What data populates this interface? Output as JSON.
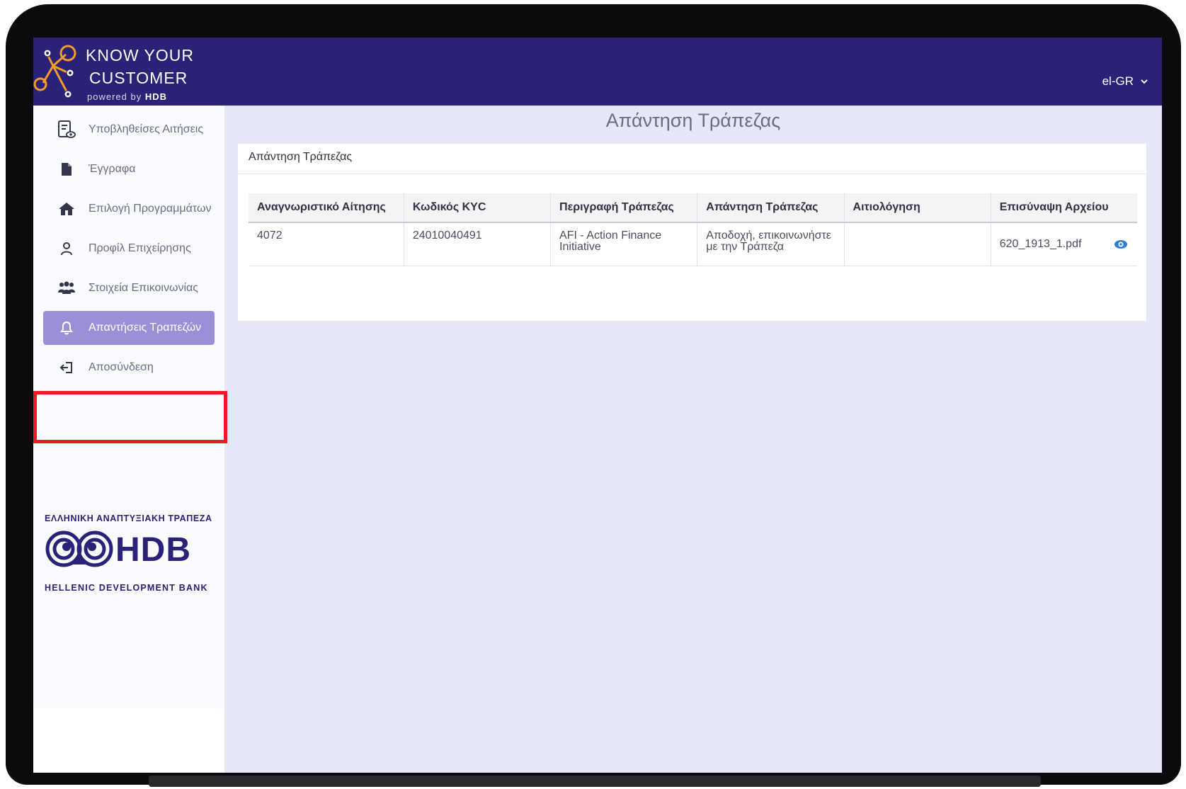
{
  "header": {
    "logo_line1": "KNOW YOUR",
    "logo_line2": "CUSTOMER",
    "logo_powered": "powered by",
    "logo_brand": "HDB",
    "language": "el-GR"
  },
  "sidebar": {
    "items": [
      {
        "label": "Υποβληθείσες Αιτήσεις",
        "icon": "document-eye-icon"
      },
      {
        "label": "Έγγραφα",
        "icon": "file-icon"
      },
      {
        "label": "Επιλογή Προγραμμάτων",
        "icon": "home-icon"
      },
      {
        "label": "Προφίλ Επιχείρησης",
        "icon": "user-icon"
      },
      {
        "label": "Στοιχεία Επικοινωνίας",
        "icon": "users-icon"
      },
      {
        "label": "Απαντήσεις Τραπεζών",
        "icon": "bell-icon",
        "active": true
      },
      {
        "label": "Αποσύνδεση",
        "icon": "logout-icon"
      }
    ],
    "bank": {
      "top_text": "ΕΛΛΗΝΙΚΗ ΑΝΑΠΤΥΞΙΑΚΗ ΤΡΑΠΕΖΑ",
      "logo_text": "HDB",
      "bottom_text": "HELLENIC DEVELOPMENT BANK"
    }
  },
  "main": {
    "page_title": "Απάντηση Τράπεζας",
    "card_title": "Απάντηση Τράπεζας",
    "table": {
      "headers": [
        "Αναγνωριστικό Αίτησης",
        "Κωδικός KYC",
        "Περιγραφή Τράπεζας",
        "Απάντηση Τράπεζας",
        "Αιτιολόγηση",
        "Επισύναψη Αρχείου"
      ],
      "rows": [
        {
          "id": "4072",
          "kyc": "24010040491",
          "bank_description": "AFI - Action Finance Initiative",
          "bank_response": "Αποδοχή, επικοινωνήστε με την Τράπεζα",
          "justification": "",
          "attachment": "620_1913_1.pdf"
        }
      ]
    }
  },
  "colors": {
    "topbar": "#2b2176",
    "active_nav": "#9b90d8",
    "highlight_border": "#ee1c25",
    "background": "#e6e8f7",
    "eye_icon": "#2f7fd6",
    "logo_orange": "#f39c2a"
  }
}
